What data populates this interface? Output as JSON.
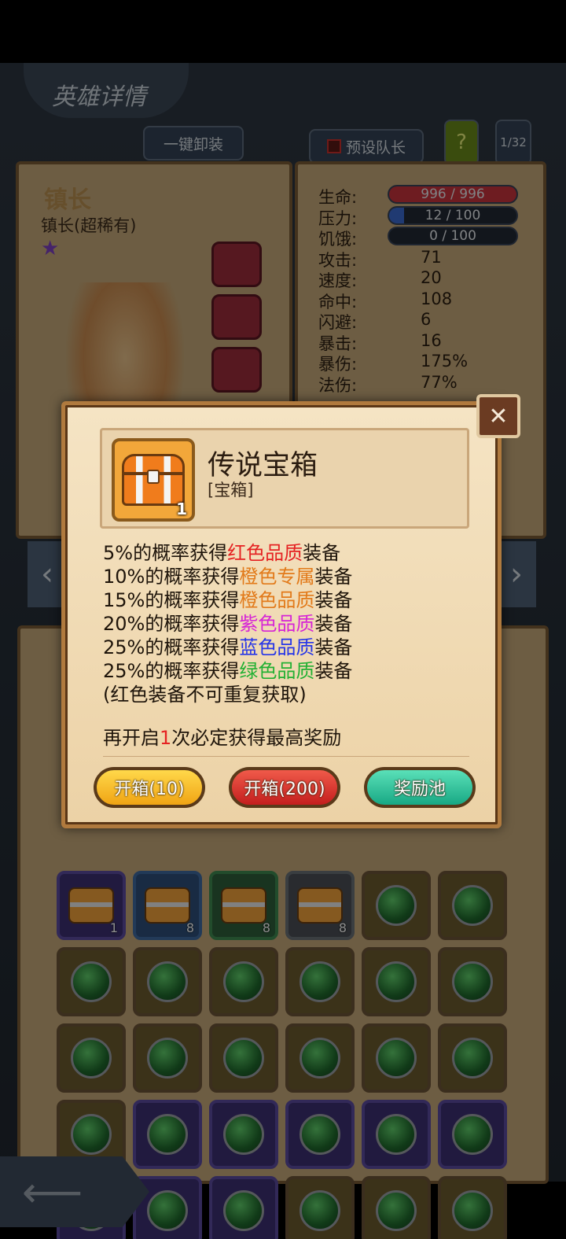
{
  "page": {
    "title": "英雄详情",
    "btn_unequip_all": "一键卸装",
    "btn_preset_captain": "预设队长",
    "help_label": "?",
    "page_counter": "1/32"
  },
  "hero": {
    "name": "镇长",
    "subtitle": "镇长(超稀有)",
    "star_icon": "purple-star-icon"
  },
  "stats": [
    {
      "label": "生命:",
      "value": "996 / 996",
      "type": "bar",
      "color": "#c8323c",
      "fill": 1.0
    },
    {
      "label": "压力:",
      "value": "12 / 100",
      "type": "bar",
      "color": "#3a6ad0",
      "fill": 0.12
    },
    {
      "label": "饥饿:",
      "value": "0 / 100",
      "type": "bar",
      "color": "#d08a2a",
      "fill": 0.0
    },
    {
      "label": "攻击:",
      "value": "71"
    },
    {
      "label": "速度:",
      "value": "20"
    },
    {
      "label": "命中:",
      "value": "108"
    },
    {
      "label": "闪避:",
      "value": "6"
    },
    {
      "label": "暴击:",
      "value": "16"
    },
    {
      "label": "暴伤:",
      "value": "175%"
    },
    {
      "label": "法伤:",
      "value": "77%"
    }
  ],
  "inventory": {
    "row1_counts": [
      "1",
      "8",
      "8",
      "8"
    ]
  },
  "modal": {
    "item_name": "传说宝箱",
    "item_type": "[宝箱]",
    "item_count": "1",
    "lines": [
      {
        "pre": "5%的概率获得",
        "hl": "红色品质",
        "post": "装备",
        "cls": "c-red"
      },
      {
        "pre": "10%的概率获得",
        "hl": "橙色专属",
        "post": "装备",
        "cls": "c-orange"
      },
      {
        "pre": "15%的概率获得",
        "hl": "橙色品质",
        "post": "装备",
        "cls": "c-orange"
      },
      {
        "pre": "20%的概率获得",
        "hl": "紫色品质",
        "post": "装备",
        "cls": "c-purple"
      },
      {
        "pre": "25%的概率获得",
        "hl": "蓝色品质",
        "post": "装备",
        "cls": "c-blue"
      },
      {
        "pre": "25%的概率获得",
        "hl": "绿色品质",
        "post": "装备",
        "cls": "c-green"
      }
    ],
    "note": "(红色装备不可重复获取)",
    "pity_pre": "再开启",
    "pity_num": "1",
    "pity_post": "次必定获得最高奖励",
    "btn_open_10": "开箱(10)",
    "btn_open_200": "开箱(200)",
    "btn_reward_pool": "奖励池",
    "close_icon": "close-x-icon"
  }
}
